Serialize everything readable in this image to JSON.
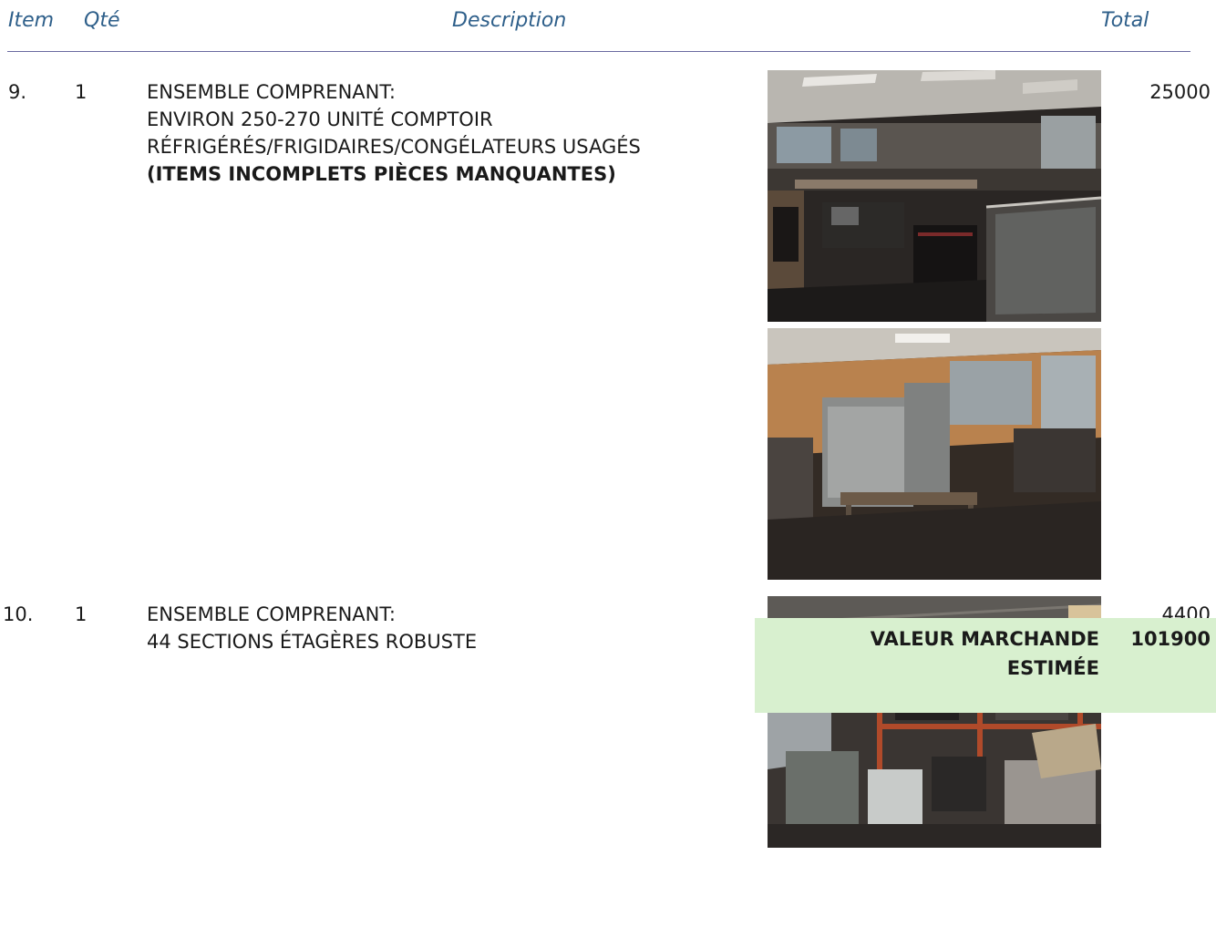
{
  "header": {
    "item": "Item",
    "qte": "Qté",
    "description": "Description",
    "total": "Total"
  },
  "items": [
    {
      "number": "9.",
      "qty": "1",
      "lines": [
        "ENSEMBLE COMPRENANT:",
        "ENVIRON 250-270 UNITÉ COMPTOIR",
        "RÉFRIGÉRÉS/FRIGIDAIRES/CONGÉLATEURS USAGÉS"
      ],
      "bold_line": "(ITEMS INCOMPLETS PIÈCES MANQUANTES)",
      "total": "25000"
    },
    {
      "number": "10.",
      "qty": "1",
      "lines": [
        "ENSEMBLE COMPRENANT:",
        "44 SECTIONS ÉTAGÈRES ROBUSTE"
      ],
      "total": "4400"
    }
  ],
  "summary": {
    "label_line1": "VALEUR MARCHANDE",
    "label_line2": "ESTIMÉE",
    "value": "101900",
    "background": "#d8f0cf"
  },
  "colors": {
    "header_text": "#2e5f8a",
    "rule": "#6a6aa0"
  }
}
